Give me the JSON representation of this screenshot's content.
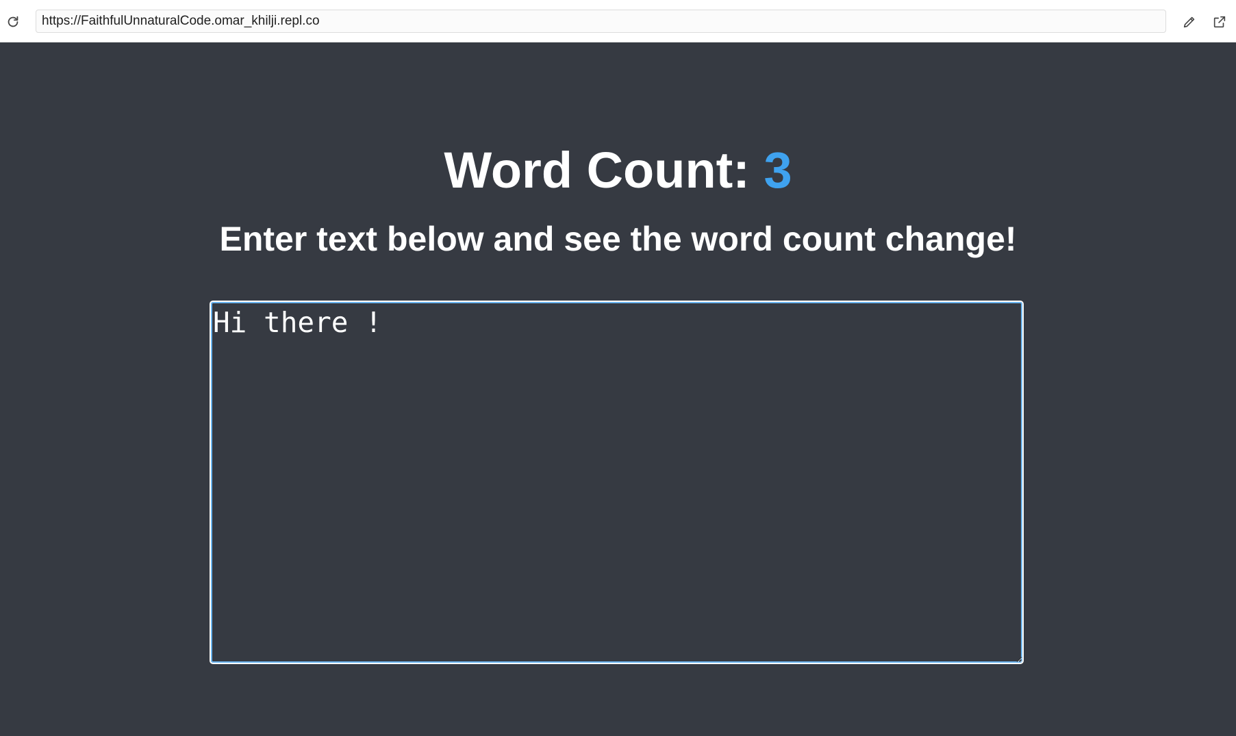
{
  "browser": {
    "url": "https://FaithfulUnnaturalCode.omar_khilji.repl.co",
    "icons": [
      "reload-icon",
      "pencil-icon",
      "open-external-icon"
    ]
  },
  "app": {
    "heading_label": "Word Count: ",
    "word_count": "3",
    "subheading": "Enter text below and see the word count change!",
    "textarea_value": "Hi there ! "
  },
  "colors": {
    "background": "#363a42",
    "text": "#ffffff",
    "count_accent": "#3fa2ef",
    "focus_ring": "#6ab4f0"
  }
}
